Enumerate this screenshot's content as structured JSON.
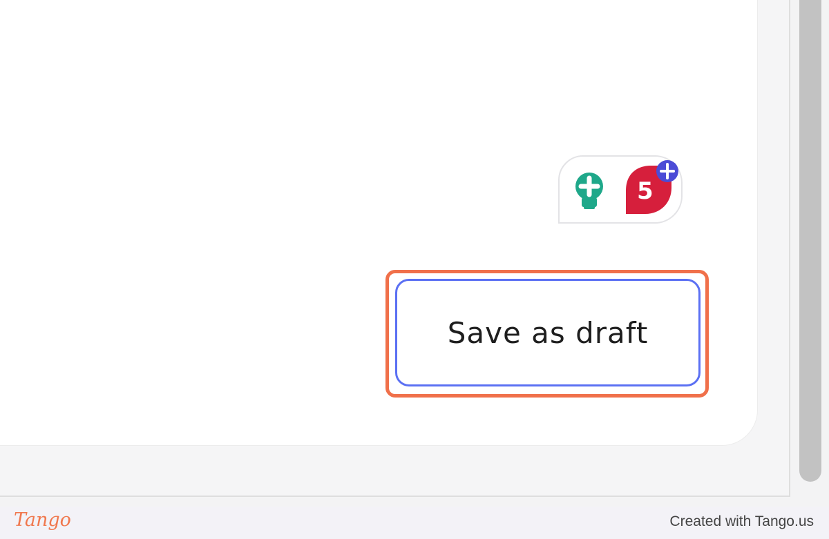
{
  "main": {
    "save_button_label": "Save as draft"
  },
  "widget": {
    "bulb_icon": "lightbulb-icon",
    "badge_count": "5",
    "badge_color": "#d61f3c",
    "bulb_color": "#1fa88a",
    "plus_color": "#4b4bd6"
  },
  "highlight_color": "#f0704a",
  "footer": {
    "logo": "Tango",
    "created_text": "Created with Tango.us"
  }
}
